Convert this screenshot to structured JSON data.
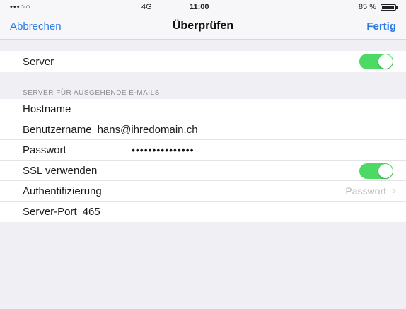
{
  "status_bar": {
    "carrier": "•••○○",
    "network": "4G",
    "time": "11:00",
    "battery_text": "85 %"
  },
  "nav": {
    "cancel_label": "Abbrechen",
    "title": "Überprüfen",
    "done_label": "Fertig",
    "accent_color": "#2a7ae4"
  },
  "server_group": {
    "label": "Server",
    "enabled": true
  },
  "section_header": "SERVER FÜR AUSGEHENDE E-MAILS",
  "fields": {
    "hostname_label": "Hostname",
    "hostname_value": "",
    "username_label": "Benutzername",
    "username_value": "hans@ihredomain.ch",
    "password_label": "Passwort",
    "password_value": "•••••••••••••••",
    "ssl_label": "SSL verwenden",
    "ssl_enabled": true,
    "auth_label": "Authentifizierung",
    "auth_value": "Passwort",
    "port_label": "Server-Port",
    "port_value": "465"
  },
  "toggle_color": "#4cd964",
  "icons": {
    "chevron": "chevron-right-icon",
    "battery": "battery-icon"
  }
}
